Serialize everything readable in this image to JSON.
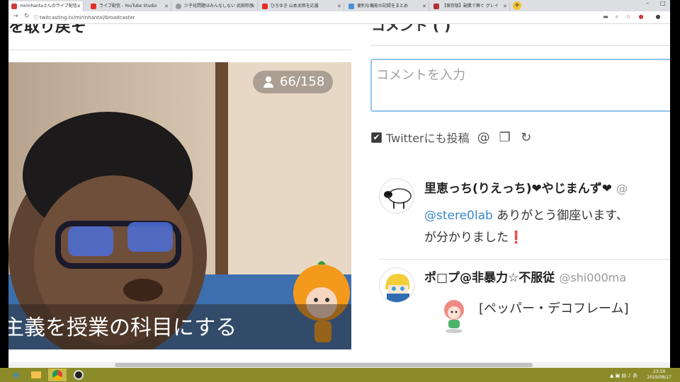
{
  "browser": {
    "tabs": [
      {
        "label": "mirinhantaさんのライブ配信",
        "active": true,
        "color": "#d23b3b"
      },
      {
        "label": "ライブ配信 - YouTube Studio",
        "active": false,
        "color": "#e52d27"
      },
      {
        "label": "少子化問題はみんなしない 武田邦彦",
        "active": false,
        "color": "#999999"
      },
      {
        "label": "ひろゆき 山本太郎を応援",
        "active": false,
        "color": "#e52d27"
      },
      {
        "label": "便利な機能の記録をまとめ",
        "active": false,
        "color": "#4a90d9"
      },
      {
        "label": "【保存版】副業で稼ぐ グレイ",
        "active": false,
        "color": "#b03030"
      }
    ],
    "url": "twitcasting.tv/mirinhantai/broadcaster"
  },
  "page": {
    "title": "を取り戻そ",
    "comment_heading": "コメント (  )",
    "viewer_count": "66/158",
    "caption": "主義を授業の科目にする",
    "comment_placeholder": "コメントを入力",
    "twitter_label": "Twitterにも投稿"
  },
  "comments": [
    {
      "name": "里恵っち(りえっち)❤やじまんず❤",
      "handle": "@",
      "mention": "@stere0lab",
      "text_line1": " ありがとう御座います、",
      "text_line2": "が分かりました",
      "mark": "❗"
    },
    {
      "name": "ポ□プ@非暴力☆不服従",
      "handle": "@shi000ma",
      "text": "[ペッパー・デコフレーム]"
    }
  ],
  "taskbar": {
    "time": "23:59",
    "date": "2019/08/17"
  },
  "colors": {
    "accent_input_border": "#8fc5ea",
    "mention": "#3a88c9",
    "taskbar": "#8b8b2a"
  }
}
